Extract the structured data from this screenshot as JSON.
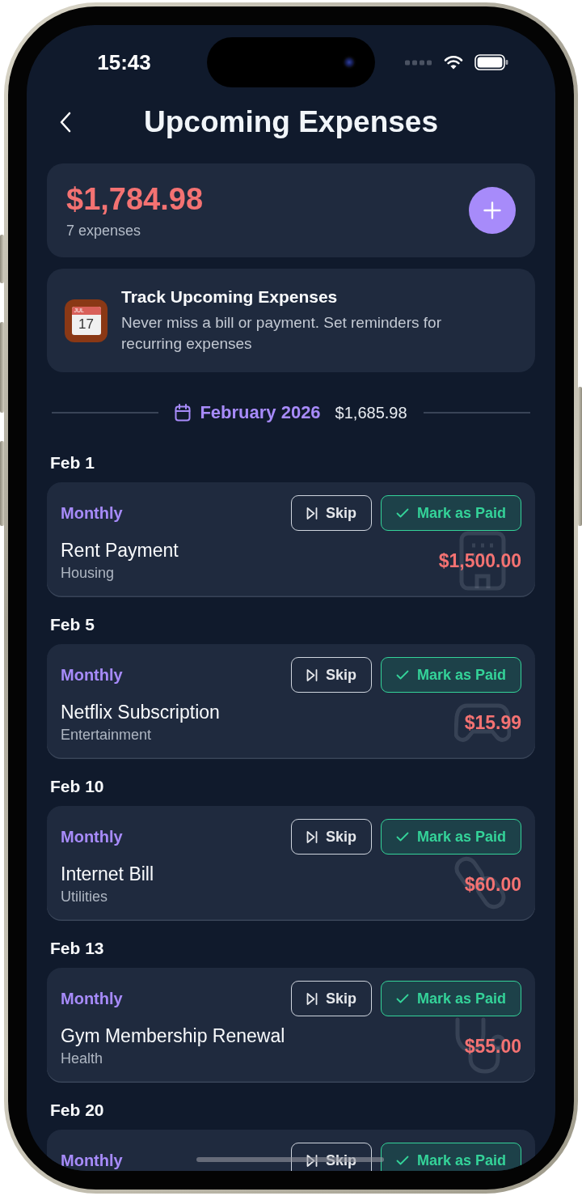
{
  "status_bar": {
    "time": "15:43"
  },
  "header": {
    "title": "Upcoming Expenses"
  },
  "summary": {
    "total": "$1,784.98",
    "count": "7 expenses"
  },
  "info_card": {
    "icon": {
      "month": "JUL",
      "day": "17"
    },
    "title": "Track Upcoming Expenses",
    "text": "Never miss a bill or payment. Set reminders for recurring expenses"
  },
  "month": {
    "label": "February 2026",
    "total": "$1,685.98"
  },
  "expenses": [
    {
      "date": "Feb 1",
      "frequency": "Monthly",
      "actions": [
        {
          "kind": "skip",
          "label": "Skip"
        },
        {
          "kind": "paid",
          "label": "Mark as Paid"
        }
      ],
      "name": "Rent Payment",
      "category": "Housing",
      "amount": "$1,500.00"
    },
    {
      "date": "Feb 5",
      "frequency": "Monthly",
      "actions": [
        {
          "kind": "skip",
          "label": "Skip"
        },
        {
          "kind": "paid",
          "label": "Mark as Paid"
        }
      ],
      "name": "Netflix Subscription",
      "category": "Entertainment",
      "amount": "$15.99"
    },
    {
      "date": "Feb 10",
      "frequency": "Monthly",
      "actions": [
        {
          "kind": "skip",
          "label": "Skip"
        },
        {
          "kind": "paid",
          "label": "Mark as Paid"
        }
      ],
      "name": "Internet Bill",
      "category": "Utilities",
      "amount": "$60.00"
    },
    {
      "date": "Feb 13",
      "frequency": "Monthly",
      "actions": [
        {
          "kind": "skip",
          "label": "Skip"
        },
        {
          "kind": "paid",
          "label": "Mark as Paid"
        }
      ],
      "name": "Gym Membership Renewal",
      "category": "Health",
      "amount": "$55.00"
    },
    {
      "date": "Feb 20",
      "frequency": "Monthly",
      "actions": [
        {
          "kind": "skip",
          "label": "Skip"
        },
        {
          "kind": "paid",
          "label": "Mark as Paid"
        }
      ]
    }
  ]
}
